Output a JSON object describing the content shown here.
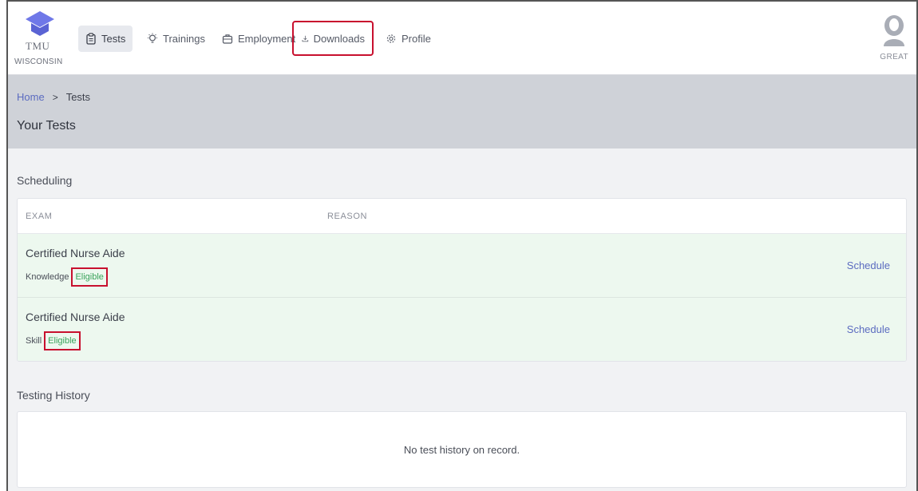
{
  "brand": {
    "name": "TMU",
    "state": "WISCONSIN",
    "cap_color": "#6f78e8"
  },
  "nav": {
    "items": [
      {
        "label": "Tests",
        "icon": "clipboard-icon",
        "active": true
      },
      {
        "label": "Trainings",
        "icon": "lightbulb-icon",
        "active": false
      },
      {
        "label": "Employment",
        "icon": "briefcase-icon",
        "active": false
      },
      {
        "label": "Downloads",
        "icon": "download-icon",
        "active": false,
        "highlighted": true
      },
      {
        "label": "Profile",
        "icon": "gear-icon",
        "active": false
      }
    ]
  },
  "user": {
    "label": "GREAT",
    "icon": "user-avatar-icon"
  },
  "breadcrumb": {
    "home": "Home",
    "separator": ">",
    "current": "Tests"
  },
  "page": {
    "title": "Your Tests"
  },
  "scheduling": {
    "title": "Scheduling",
    "columns": [
      "EXAM",
      "REASON"
    ],
    "rows": [
      {
        "exam": "Certified Nurse Aide",
        "type": "Knowledge",
        "status": "Eligible",
        "action": "Schedule"
      },
      {
        "exam": "Certified Nurse Aide",
        "type": "Skill",
        "status": "Eligible",
        "action": "Schedule"
      }
    ]
  },
  "history": {
    "title": "Testing History",
    "empty_message": "No test history on record."
  },
  "colors": {
    "accent": "#5b6bc0",
    "eligible": "#3aa35b",
    "highlight": "#c8102e",
    "row_bg": "#edf8ef",
    "header_bg": "#cfd2d8"
  }
}
